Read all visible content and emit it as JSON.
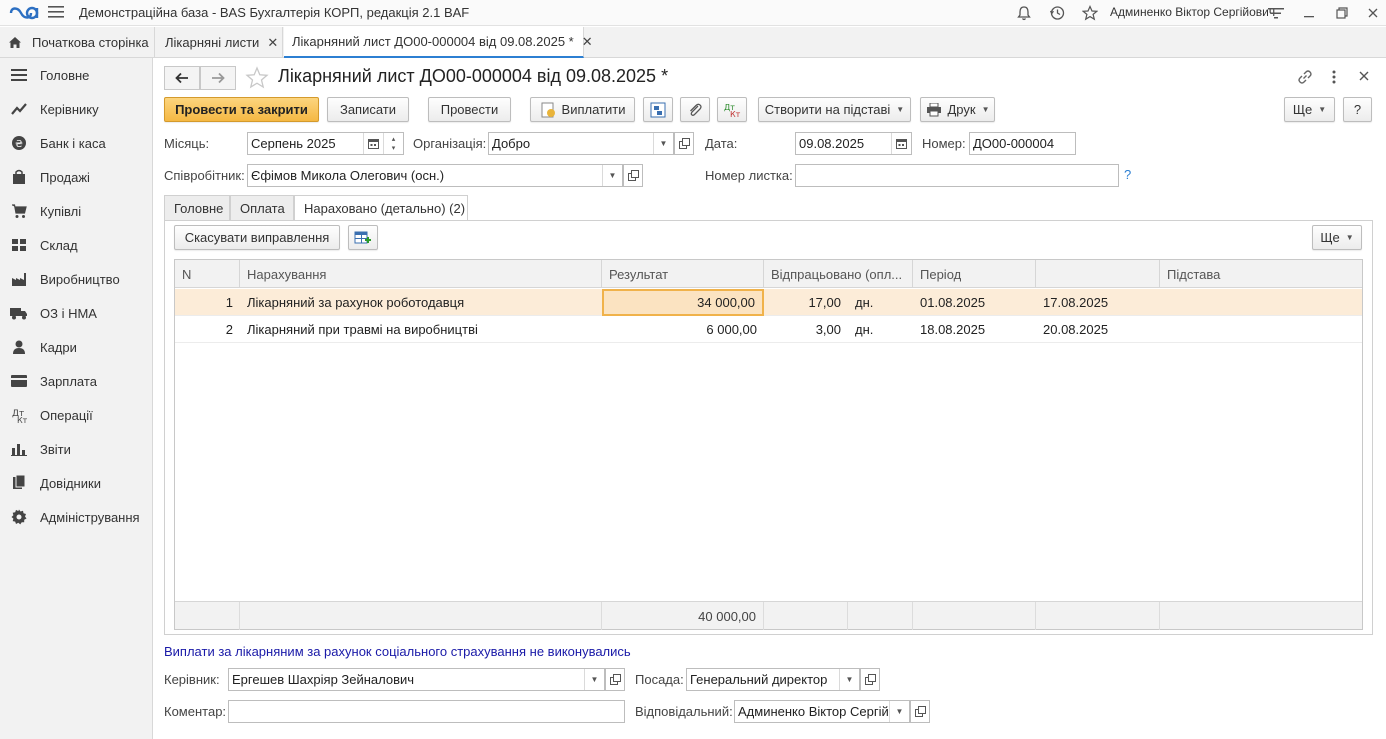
{
  "app": {
    "title": "Демонстраційна база - BAS Бухгалтерія КОРП, редакція 2.1 BAF",
    "user": "Админенко Віктор Сергійович"
  },
  "tabs": [
    {
      "label": "Початкова сторінка"
    },
    {
      "label": "Лікарняні листи"
    },
    {
      "label": "Лікарняний лист ДО00-000004 від 09.08.2025 *"
    }
  ],
  "sidebar": {
    "items": [
      {
        "label": "Головне",
        "icon": "menu-lines-icon"
      },
      {
        "label": "Керівнику",
        "icon": "trend-icon"
      },
      {
        "label": "Банк і каса",
        "icon": "coin-icon"
      },
      {
        "label": "Продажі",
        "icon": "bag-icon"
      },
      {
        "label": "Купівлі",
        "icon": "cart-icon"
      },
      {
        "label": "Склад",
        "icon": "boxes-icon"
      },
      {
        "label": "Виробництво",
        "icon": "factory-icon"
      },
      {
        "label": "ОЗ і НМА",
        "icon": "truck-icon"
      },
      {
        "label": "Кадри",
        "icon": "person-icon"
      },
      {
        "label": "Зарплата",
        "icon": "card-icon"
      },
      {
        "label": "Операції",
        "icon": "operations-icon"
      },
      {
        "label": "Звіти",
        "icon": "bar-chart-icon"
      },
      {
        "label": "Довідники",
        "icon": "books-icon"
      },
      {
        "label": "Адміністрування",
        "icon": "gear-icon"
      }
    ]
  },
  "document": {
    "title": "Лікарняний лист ДО00-000004 від 09.08.2025 *"
  },
  "toolbar": {
    "post_close": "Провести та закрити",
    "save": "Записати",
    "post": "Провести",
    "pay": "Виплатити",
    "create_based": "Створити на підставі",
    "print": "Друк",
    "more": "Ще",
    "help": "?"
  },
  "form": {
    "month_label": "Місяць:",
    "month_value": "Серпень 2025",
    "org_label": "Організація:",
    "org_value": "Добро",
    "date_label": "Дата:",
    "date_value": "09.08.2025",
    "number_label": "Номер:",
    "number_value": "ДО00-000004",
    "employee_label": "Співробітник:",
    "employee_value": "Єфімов Микола Олегович (осн.)",
    "sheet_number_label": "Номер листка:",
    "sheet_number_value": "",
    "sheet_help": "?"
  },
  "inner_tabs": [
    {
      "label": "Головне"
    },
    {
      "label": "Оплата"
    },
    {
      "label": "Нараховано (детально) (2)"
    }
  ],
  "table_toolbar": {
    "cancel_fix": "Скасувати виправлення",
    "more": "Ще"
  },
  "table": {
    "columns": [
      "N",
      "Нарахування",
      "Результат",
      "Відпрацьовано (опл...",
      "Період",
      "",
      "Підстава"
    ],
    "rows": [
      {
        "n": "1",
        "accrual": "Лікарняний за рахунок роботодавця",
        "result": "34 000,00",
        "worked": "17,00",
        "unit": "дн.",
        "from": "01.08.2025",
        "to": "17.08.2025",
        "basis": ""
      },
      {
        "n": "2",
        "accrual": "Лікарняний при травмі на виробництві",
        "result": "6 000,00",
        "worked": "3,00",
        "unit": "дн.",
        "from": "18.08.2025",
        "to": "20.08.2025",
        "basis": ""
      }
    ],
    "total_result": "40 000,00"
  },
  "footer": {
    "info_link": "Виплати за лікарняним за рахунок соціального страхування не виконувались",
    "manager_label": "Керівник:",
    "manager_value": "Ергешев Шахріяр Зейналович",
    "position_label": "Посада:",
    "position_value": "Генеральний директор",
    "comment_label": "Коментар:",
    "comment_value": "",
    "responsible_label": "Відповідальний:",
    "responsible_value": "Админенко Віктор Сергійович"
  },
  "colors": {
    "primary_button": "#f5b843",
    "selected_row": "#fcecd8",
    "link": "#1a1aa8",
    "active_tab_underline": "#2c7fd2"
  }
}
